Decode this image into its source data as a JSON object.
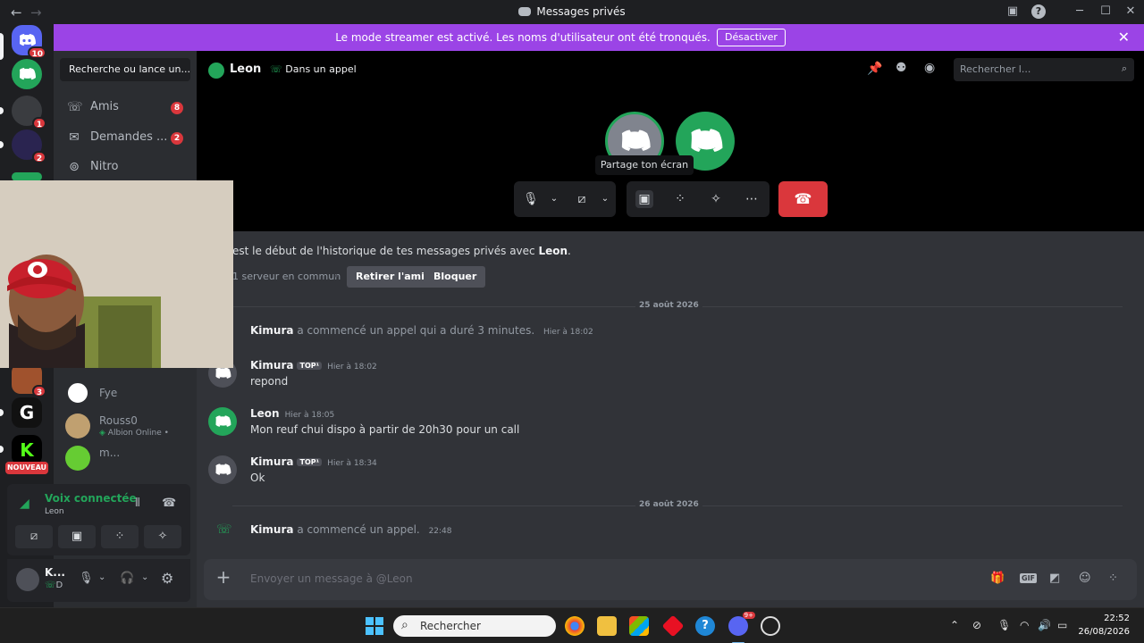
{
  "window": {
    "title": "Messages privés"
  },
  "banner": {
    "text": "Le mode streamer est activé. Les noms d'utilisateur ont été tronqués.",
    "button": "Désactiver",
    "color": "#9b44e6"
  },
  "rail": {
    "home_badge": "10",
    "server_badges": [
      "1",
      "2",
      "3"
    ],
    "new_label": "NOUVEAU"
  },
  "sidebar": {
    "search_placeholder": "Recherche ou lance un...",
    "nav": [
      {
        "label": "Amis",
        "count": "8",
        "icon": "friends-icon"
      },
      {
        "label": "Demandes ...",
        "count": "2",
        "icon": "mail-icon"
      },
      {
        "label": "Nitro",
        "count": "",
        "icon": "nitro-icon"
      }
    ],
    "dms": [
      {
        "name": "Fye",
        "sub": ""
      },
      {
        "name": "Rouss0",
        "sub": "Albion Online • "
      },
      {
        "name": "m...",
        "sub": ""
      }
    ]
  },
  "voice": {
    "status": "Voix connectée",
    "channel": "Leon"
  },
  "user": {
    "name": "K...",
    "status": "D"
  },
  "header": {
    "name": "Leon",
    "call_status": "Dans un appel",
    "search_placeholder": "Rechercher l..."
  },
  "call": {
    "tooltip": "Partage ton écran"
  },
  "intro": {
    "text_prefix": "est le début de l'historique de tes messages privés avec ",
    "text_name": "Leon",
    "text_suffix": ".",
    "mutual": "1 serveur en commun",
    "remove_friend": "Retirer l'ami",
    "block": "Bloquer"
  },
  "dates": [
    "25 août 2026",
    "26 août 2026"
  ],
  "messages": [
    {
      "author": "Kimura",
      "system": "a commencé un appel qui a duré 3 minutes.",
      "time": "Hier à 18:02"
    },
    {
      "author": "Kimura",
      "tag": "TOP¹",
      "time": "Hier à 18:02",
      "text": "repond"
    },
    {
      "author": "Leon",
      "time": "Hier à 18:05",
      "text": "Mon reuf chui dispo à partir de  20h30 pour un call"
    },
    {
      "author": "Kimura",
      "tag": "TOP¹",
      "time": "Hier à 18:34",
      "text": "Ok"
    },
    {
      "author": "Kimura",
      "system": "a commencé un appel.",
      "time": "22:48"
    }
  ],
  "composer": {
    "placeholder": "Envoyer un message à @Leon",
    "gif": "GIF"
  },
  "taskbar": {
    "search": "Rechercher",
    "time": "22:52",
    "date": "26/08/2026",
    "discord_badge": "9+"
  },
  "colors": {
    "green": "#23a55a",
    "red": "#da373c",
    "blurple": "#5865f2"
  }
}
